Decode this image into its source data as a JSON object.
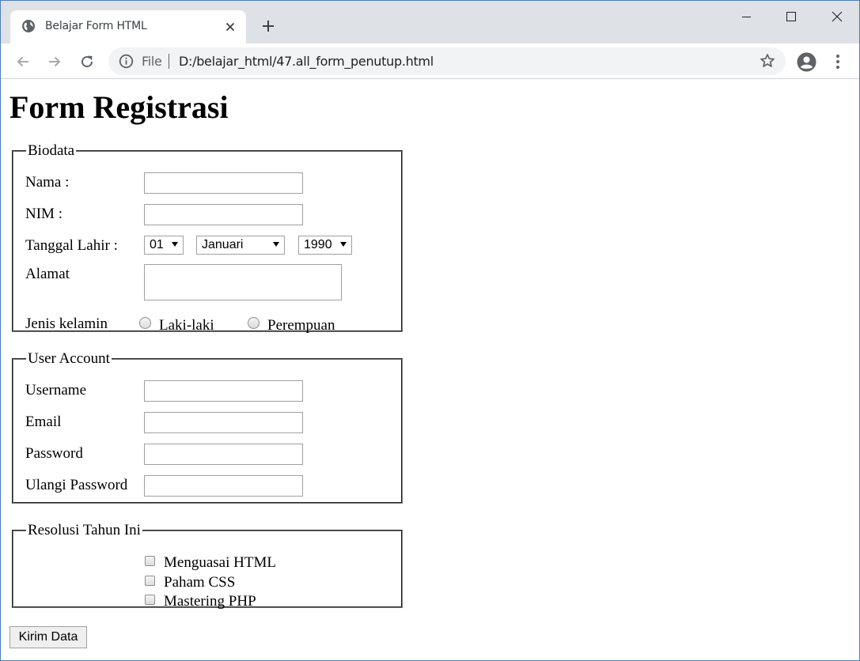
{
  "browser": {
    "tab_title": "Belajar Form HTML",
    "url_scheme_label": "File",
    "url": "D:/belajar_html/47.all_form_penutup.html"
  },
  "page": {
    "heading": "Form Registrasi",
    "biodata": {
      "legend": "Biodata",
      "nama_label": "Nama :",
      "nama_value": "",
      "nim_label": "NIM :",
      "nim_value": "",
      "tanggal_label": "Tanggal Lahir :",
      "day_selected": "01",
      "month_selected": "Januari",
      "year_selected": "1990",
      "alamat_label": "Alamat",
      "alamat_value": "",
      "gender_label": "Jenis kelamin",
      "gender_options": [
        "Laki-laki",
        "Perempuan"
      ]
    },
    "user_account": {
      "legend": "User Account",
      "username_label": "Username",
      "email_label": "Email",
      "password_label": "Password",
      "repeat_password_label": "Ulangi Password"
    },
    "resolusi": {
      "legend": "Resolusi Tahun Ini",
      "options": [
        "Menguasai HTML",
        "Paham CSS",
        "Mastering PHP"
      ]
    },
    "submit_label": "Kirim Data"
  }
}
